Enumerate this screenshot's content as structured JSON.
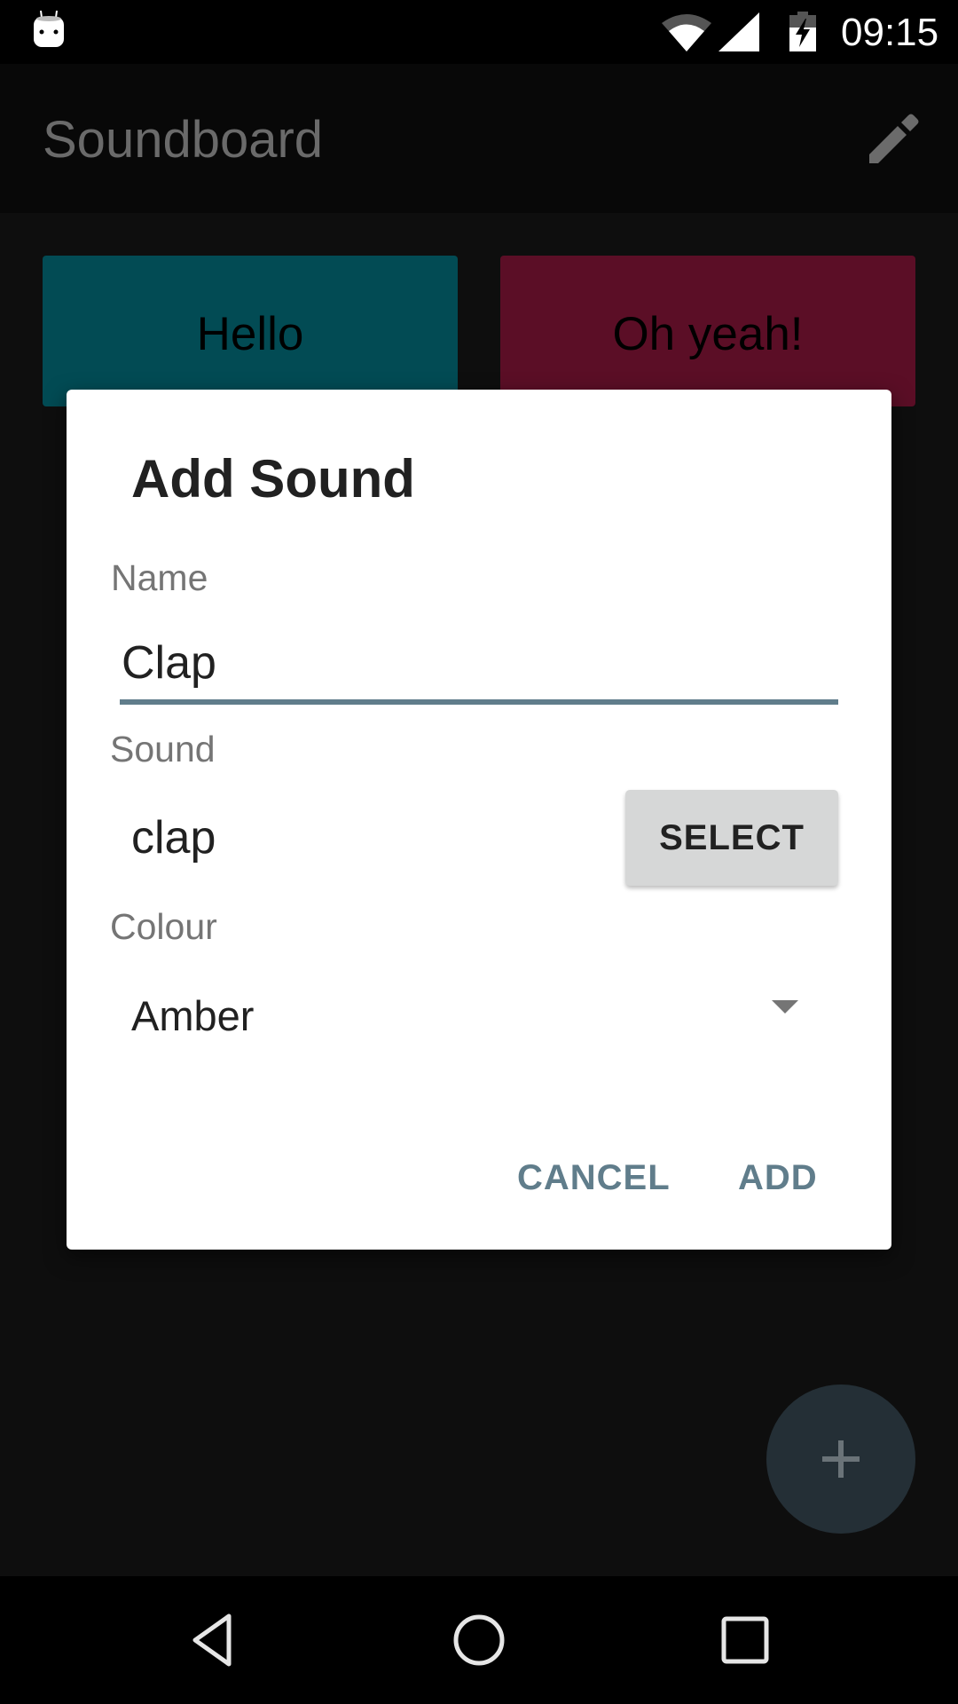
{
  "status_bar": {
    "time": "09:15",
    "icons": [
      "android-notification-icon",
      "wifi-icon",
      "cell-signal-icon",
      "battery-charging-icon"
    ]
  },
  "app_bar": {
    "title": "Soundboard",
    "action_icon": "edit-pencil-icon"
  },
  "tiles": [
    {
      "label": "Hello",
      "color": "#024b54"
    },
    {
      "label": "Oh yeah!",
      "color": "#5b0e26"
    }
  ],
  "fab": {
    "icon": "plus-icon",
    "color": "#242f36"
  },
  "dialog": {
    "title": "Add Sound",
    "name_label": "Name",
    "name_value": "Clap",
    "sound_label": "Sound",
    "sound_value": "clap",
    "select_button": "SELECT",
    "colour_label": "Colour",
    "colour_value": "Amber",
    "cancel_button": "CANCEL",
    "add_button": "ADD",
    "accent_color": "#607d8b"
  },
  "nav_bar": {
    "buttons": [
      "back-icon",
      "home-icon",
      "recents-icon"
    ]
  }
}
